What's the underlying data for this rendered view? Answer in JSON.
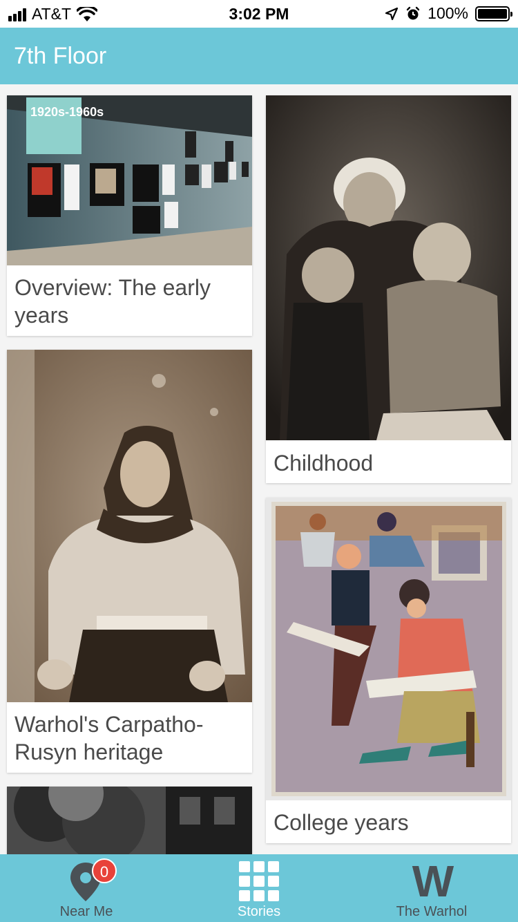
{
  "status_bar": {
    "carrier": "AT&T",
    "time": "3:02 PM",
    "battery": "100%"
  },
  "header": {
    "title": "7th Floor"
  },
  "stories": [
    {
      "label": "Overview: The early years",
      "image": "gallery-wall-photo",
      "image_caption": "1920s-1960s"
    },
    {
      "label": "Childhood",
      "image": "family-portrait-photo"
    },
    {
      "label": "Warhol's Carpatho-Rusyn heritage",
      "image": "woman-portrait-photo"
    },
    {
      "label": "College years",
      "image": "art-class-painting"
    },
    {
      "label": "",
      "image": "street-trees-photo"
    }
  ],
  "tabbar": {
    "near_me": {
      "label": "Near Me",
      "badge": "0"
    },
    "stories": {
      "label": "Stories"
    },
    "warhol": {
      "label": "The Warhol",
      "logo": "W"
    }
  },
  "colors": {
    "accent": "#6cc7d8",
    "badge": "#e8423a"
  }
}
